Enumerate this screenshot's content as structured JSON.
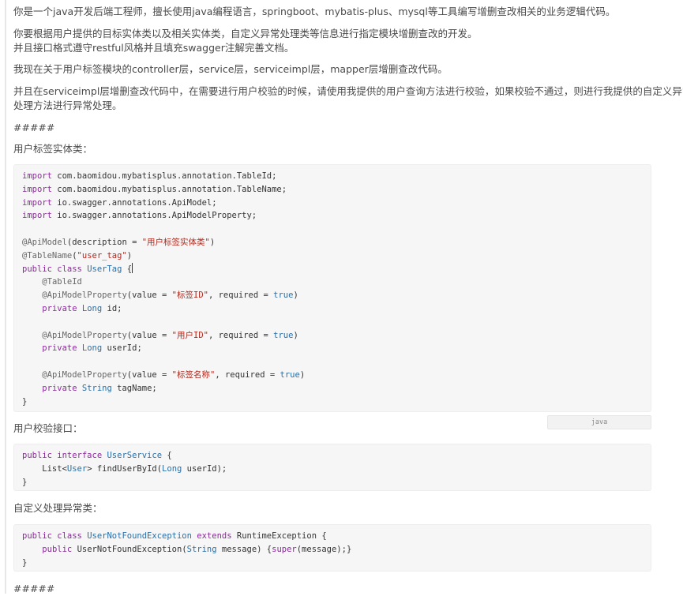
{
  "paragraphs": {
    "p1": "你是一个java开发后端工程师，擅长使用java编程语言，springboot、mybatis-plus、mysql等工具编写增删查改相关的业务逻辑代码。",
    "p2a": "你要根据用户提供的目标实体类以及相关实体类，自定义异常处理类等信息进行指定模块增删查改的开发。",
    "p2b": "并且接口格式遵守restful风格并且填充swagger注解完善文档。",
    "p3": "我现在关于用户标签模块的controller层，service层，serviceimpl层，mapper层增删查改代码。",
    "p4a": "并且在serviceimpl层增删查改代码中，在需要进行用户校验的时候，请使用我提供的用户查询方法进行校验，如果校验不通过，则进行我提供的自定义异常",
    "p4b": "处理方法进行异常处理。",
    "sep1": "#####",
    "label1": "用户标签实体类：",
    "label2": "用户校验接口：",
    "label3": "自定义处理异常类：",
    "sep2": "#####"
  },
  "code1": {
    "import1": "com.baomidou.mybatisplus.annotation.TableId;",
    "import2": "com.baomidou.mybatisplus.annotation.TableName;",
    "import3": "io.swagger.annotations.ApiModel;",
    "import4": "io.swagger.annotations.ApiModelProperty;",
    "apimodel_desc": "\"用户标签实体类\"",
    "tablename": "\"user_tag\"",
    "class_name": "UserTag",
    "prop1_value": "\"标签ID\"",
    "prop2_value": "\"用户ID\"",
    "prop3_value": "\"标签名称\"",
    "field1": "id;",
    "field2": "userId;",
    "field3": "tagName;"
  },
  "lang_badge": "java",
  "code2": {
    "interface_name": "UserService",
    "method": "findUserById(",
    "param": "userId);"
  },
  "code3": {
    "class_name": "UserNotFoundException",
    "parent": "RuntimeException",
    "ctor": "UserNotFoundException(",
    "param": "message) {"
  }
}
